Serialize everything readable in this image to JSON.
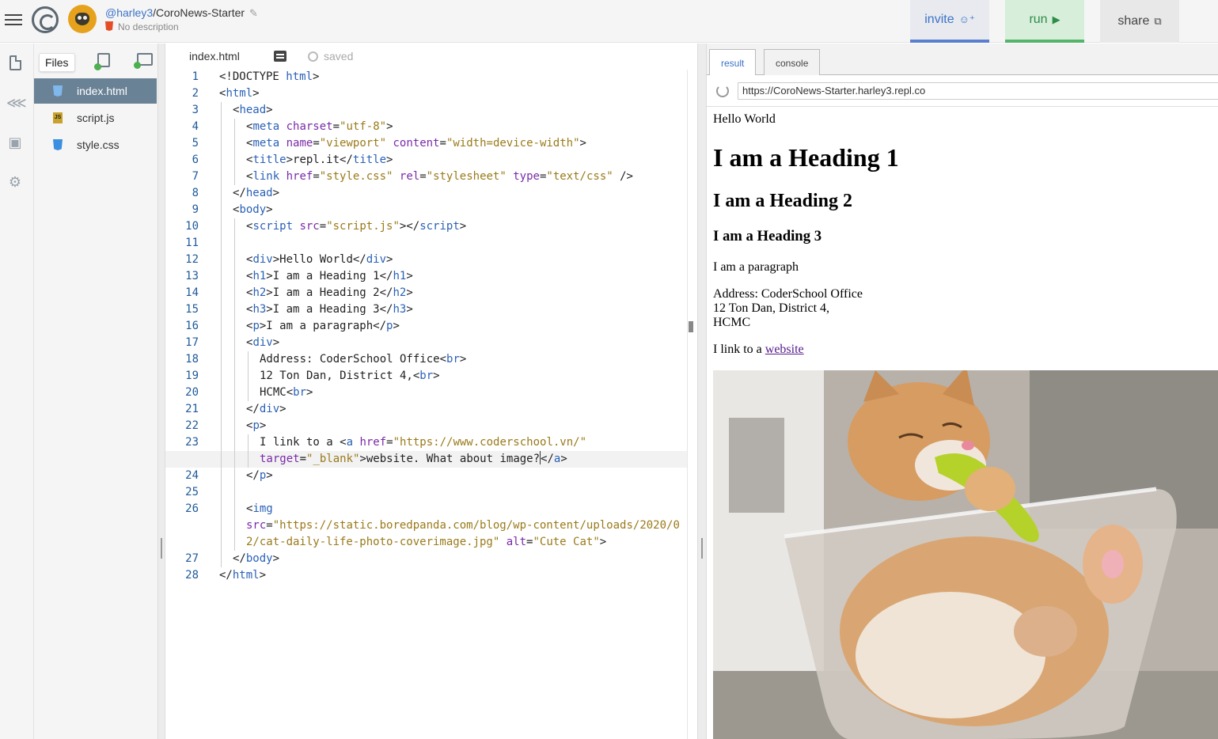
{
  "header": {
    "user": "@harley3",
    "separator": "/",
    "repl_name": "CoroNews-Starter",
    "description": "No description",
    "invite_label": "invite",
    "run_label": "run",
    "share_label": "share"
  },
  "files": {
    "tooltip": "Files",
    "items": [
      {
        "name": "index.html",
        "type": "html",
        "active": true
      },
      {
        "name": "script.js",
        "type": "js",
        "active": false
      },
      {
        "name": "style.css",
        "type": "css",
        "active": false
      }
    ]
  },
  "editor": {
    "tab": "index.html",
    "status": "saved"
  },
  "output": {
    "tabs": [
      "result",
      "console"
    ],
    "url": "https://CoroNews-Starter.harley3.repl.co",
    "preview": {
      "div": "Hello World",
      "h1": "I am a Heading 1",
      "h2": "I am a Heading 2",
      "h3": "I am a Heading 3",
      "p": "I am a paragraph",
      "address": [
        "Address: CoderSchool Office",
        "12 Ton Dan, District 4,",
        "HCMC"
      ],
      "link_prefix": "I link to a ",
      "link_text": "website",
      "image_alt": "Cute Cat"
    }
  },
  "colors": {
    "accent_blue": "#3b73c8",
    "run_green": "#2f8c47",
    "active_file_bg": "#6a8296",
    "tag_color": "#2a61b7",
    "attr_color": "#7a2aa8",
    "string_color": "#9a7a1a"
  },
  "icons": [
    "menu-icon",
    "replit-logo-icon",
    "user-avatar-icon",
    "pencil-icon",
    "html5-icon",
    "add-user-icon",
    "play-icon",
    "share-icon",
    "files-icon",
    "version-control-icon",
    "packages-icon",
    "settings-icon",
    "add-file-icon",
    "add-folder-icon",
    "format-icon",
    "history-icon",
    "refresh-icon"
  ],
  "code_lines": [
    {
      "n": "1",
      "indent": 0,
      "segs": [
        [
          "p",
          "<!DOCTYPE "
        ],
        [
          "t",
          "html"
        ],
        [
          "p",
          ">"
        ]
      ]
    },
    {
      "n": "2",
      "indent": 0,
      "segs": [
        [
          "p",
          "<"
        ],
        [
          "t",
          "html"
        ],
        [
          "p",
          ">"
        ]
      ]
    },
    {
      "n": "3",
      "indent": 1,
      "segs": [
        [
          "p",
          "<"
        ],
        [
          "t",
          "head"
        ],
        [
          "p",
          ">"
        ]
      ]
    },
    {
      "n": "4",
      "indent": 2,
      "segs": [
        [
          "p",
          "<"
        ],
        [
          "t",
          "meta "
        ],
        [
          "a",
          "charset"
        ],
        [
          "p",
          "="
        ],
        [
          "s",
          "\"utf-8\""
        ],
        [
          "p",
          ">"
        ]
      ]
    },
    {
      "n": "5",
      "indent": 2,
      "segs": [
        [
          "p",
          "<"
        ],
        [
          "t",
          "meta "
        ],
        [
          "a",
          "name"
        ],
        [
          "p",
          "="
        ],
        [
          "s",
          "\"viewport\""
        ],
        [
          "p",
          " "
        ],
        [
          "a",
          "content"
        ],
        [
          "p",
          "="
        ],
        [
          "s",
          "\"width=device-width\""
        ],
        [
          "p",
          ">"
        ]
      ]
    },
    {
      "n": "6",
      "indent": 2,
      "segs": [
        [
          "p",
          "<"
        ],
        [
          "t",
          "title"
        ],
        [
          "p",
          ">repl.it</"
        ],
        [
          "t",
          "title"
        ],
        [
          "p",
          ">"
        ]
      ]
    },
    {
      "n": "7",
      "indent": 2,
      "segs": [
        [
          "p",
          "<"
        ],
        [
          "t",
          "link "
        ],
        [
          "a",
          "href"
        ],
        [
          "p",
          "="
        ],
        [
          "s",
          "\"style.css\""
        ],
        [
          "p",
          " "
        ],
        [
          "a",
          "rel"
        ],
        [
          "p",
          "="
        ],
        [
          "s",
          "\"stylesheet\""
        ],
        [
          "p",
          " "
        ],
        [
          "a",
          "type"
        ],
        [
          "p",
          "="
        ],
        [
          "s",
          "\"text/css\""
        ],
        [
          "p",
          " />"
        ]
      ]
    },
    {
      "n": "8",
      "indent": 1,
      "segs": [
        [
          "p",
          "</"
        ],
        [
          "t",
          "head"
        ],
        [
          "p",
          ">"
        ]
      ]
    },
    {
      "n": "9",
      "indent": 1,
      "segs": [
        [
          "p",
          "<"
        ],
        [
          "t",
          "body"
        ],
        [
          "p",
          ">"
        ]
      ]
    },
    {
      "n": "10",
      "indent": 2,
      "segs": [
        [
          "p",
          "<"
        ],
        [
          "t",
          "script "
        ],
        [
          "a",
          "src"
        ],
        [
          "p",
          "="
        ],
        [
          "s",
          "\"script.js\""
        ],
        [
          "p",
          "></"
        ],
        [
          "t",
          "script"
        ],
        [
          "p",
          ">"
        ]
      ]
    },
    {
      "n": "11",
      "indent": 2,
      "segs": []
    },
    {
      "n": "12",
      "indent": 2,
      "segs": [
        [
          "p",
          "<"
        ],
        [
          "t",
          "div"
        ],
        [
          "p",
          ">Hello World</"
        ],
        [
          "t",
          "div"
        ],
        [
          "p",
          ">"
        ]
      ]
    },
    {
      "n": "13",
      "indent": 2,
      "segs": [
        [
          "p",
          "<"
        ],
        [
          "t",
          "h1"
        ],
        [
          "p",
          ">I am a Heading 1</"
        ],
        [
          "t",
          "h1"
        ],
        [
          "p",
          ">"
        ]
      ]
    },
    {
      "n": "14",
      "indent": 2,
      "segs": [
        [
          "p",
          "<"
        ],
        [
          "t",
          "h2"
        ],
        [
          "p",
          ">I am a Heading 2</"
        ],
        [
          "t",
          "h2"
        ],
        [
          "p",
          ">"
        ]
      ]
    },
    {
      "n": "15",
      "indent": 2,
      "segs": [
        [
          "p",
          "<"
        ],
        [
          "t",
          "h3"
        ],
        [
          "p",
          ">I am a Heading 3</"
        ],
        [
          "t",
          "h3"
        ],
        [
          "p",
          ">"
        ]
      ]
    },
    {
      "n": "16",
      "indent": 2,
      "segs": [
        [
          "p",
          "<"
        ],
        [
          "t",
          "p"
        ],
        [
          "p",
          ">I am a paragraph</"
        ],
        [
          "t",
          "p"
        ],
        [
          "p",
          ">"
        ]
      ]
    },
    {
      "n": "17",
      "indent": 2,
      "segs": [
        [
          "p",
          "<"
        ],
        [
          "t",
          "div"
        ],
        [
          "p",
          ">"
        ]
      ]
    },
    {
      "n": "18",
      "indent": 3,
      "segs": [
        [
          "p",
          "Address: CoderSchool Office<"
        ],
        [
          "t",
          "br"
        ],
        [
          "p",
          ">"
        ]
      ]
    },
    {
      "n": "19",
      "indent": 3,
      "segs": [
        [
          "p",
          "12 Ton Dan, District 4,<"
        ],
        [
          "t",
          "br"
        ],
        [
          "p",
          ">"
        ]
      ]
    },
    {
      "n": "20",
      "indent": 3,
      "segs": [
        [
          "p",
          "HCMC<"
        ],
        [
          "t",
          "br"
        ],
        [
          "p",
          ">"
        ]
      ]
    },
    {
      "n": "21",
      "indent": 2,
      "segs": [
        [
          "p",
          "</"
        ],
        [
          "t",
          "div"
        ],
        [
          "p",
          ">"
        ]
      ]
    },
    {
      "n": "22",
      "indent": 2,
      "segs": [
        [
          "p",
          "<"
        ],
        [
          "t",
          "p"
        ],
        [
          "p",
          ">"
        ]
      ]
    },
    {
      "n": "23",
      "indent": 3,
      "segs": [
        [
          "p",
          "I link to a <"
        ],
        [
          "t",
          "a "
        ],
        [
          "a",
          "href"
        ],
        [
          "p",
          "="
        ],
        [
          "s",
          "\"https://www.coderschool.vn/\""
        ]
      ]
    },
    {
      "n": "",
      "indent": 3,
      "hl": true,
      "segs": [
        [
          "a",
          "target"
        ],
        [
          "p",
          "="
        ],
        [
          "s",
          "\"_blank\""
        ],
        [
          "p",
          ">website. What about image?"
        ],
        [
          "c",
          ""
        ],
        [
          "p",
          "</"
        ],
        [
          "t",
          "a"
        ],
        [
          "p",
          ">"
        ]
      ]
    },
    {
      "n": "24",
      "indent": 2,
      "segs": [
        [
          "p",
          "</"
        ],
        [
          "t",
          "p"
        ],
        [
          "p",
          ">"
        ]
      ]
    },
    {
      "n": "25",
      "indent": 2,
      "segs": []
    },
    {
      "n": "26",
      "indent": 2,
      "segs": [
        [
          "p",
          "<"
        ],
        [
          "t",
          "img"
        ]
      ]
    },
    {
      "n": "",
      "indent": 2,
      "segs": [
        [
          "a",
          "src"
        ],
        [
          "p",
          "="
        ],
        [
          "s",
          "\"https://static.boredpanda.com/blog/wp-content/uploads/2020/0"
        ]
      ]
    },
    {
      "n": "",
      "indent": 2,
      "segs": [
        [
          "s",
          "2/cat-daily-life-photo-coverimage.jpg\""
        ],
        [
          "p",
          " "
        ],
        [
          "a",
          "alt"
        ],
        [
          "p",
          "="
        ],
        [
          "s",
          "\"Cute Cat\""
        ],
        [
          "p",
          ">"
        ]
      ]
    },
    {
      "n": "27",
      "indent": 1,
      "segs": [
        [
          "p",
          "</"
        ],
        [
          "t",
          "body"
        ],
        [
          "p",
          ">"
        ]
      ]
    },
    {
      "n": "28",
      "indent": 0,
      "segs": [
        [
          "p",
          "</"
        ],
        [
          "t",
          "html"
        ],
        [
          "p",
          ">"
        ]
      ]
    }
  ]
}
